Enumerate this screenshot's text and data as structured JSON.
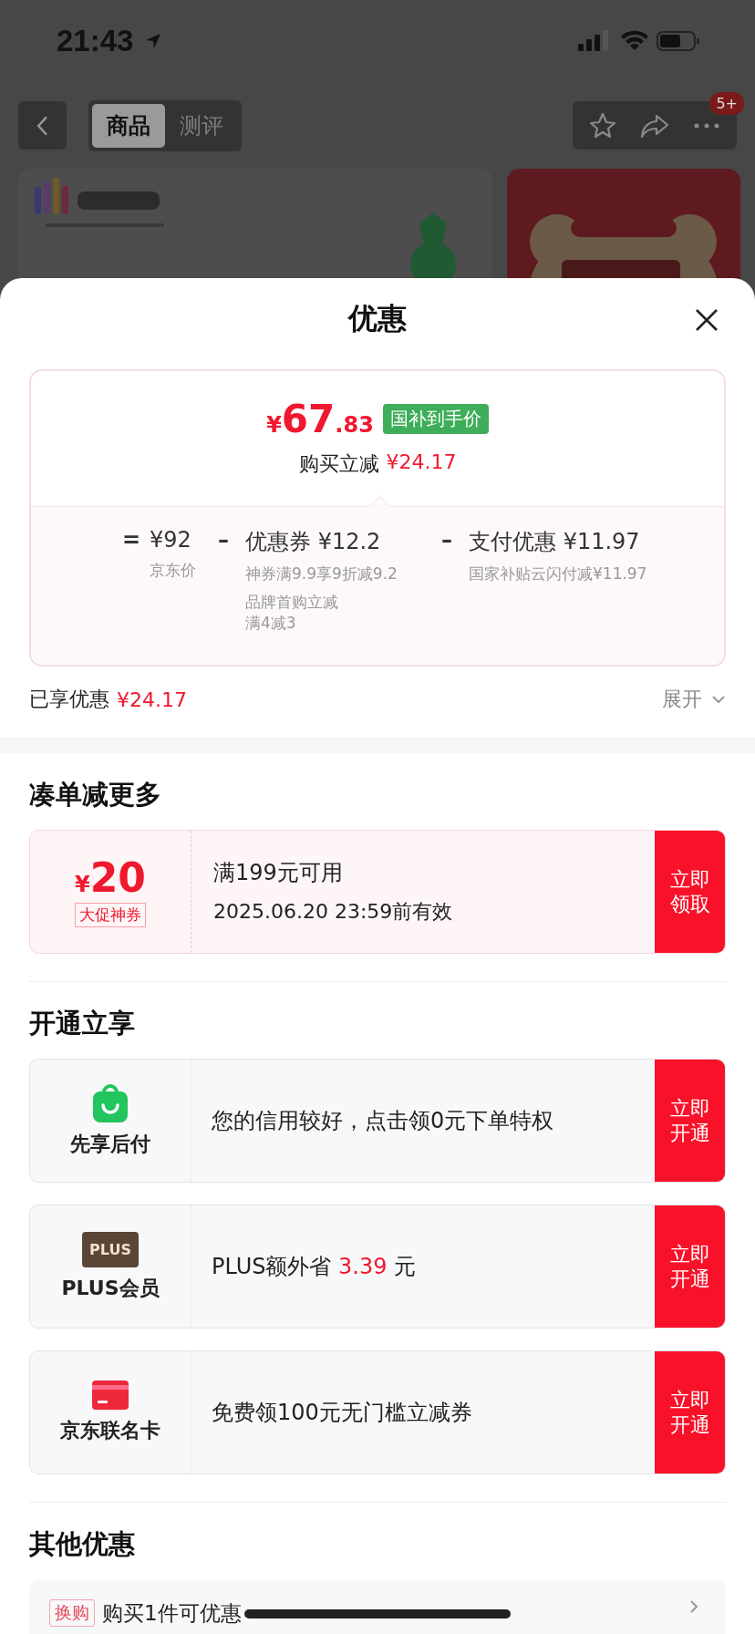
{
  "status_bar": {
    "time": "21:43"
  },
  "nav": {
    "tabs": [
      {
        "label": "商品",
        "selected": true
      },
      {
        "label": "测评",
        "selected": false
      }
    ],
    "badge": "5+"
  },
  "sheet": {
    "title": "优惠"
  },
  "price_card": {
    "currency": "¥",
    "price_int": "67",
    "price_dec": ".83",
    "tag": "国补到手价",
    "saving_label": "购买立减",
    "saving_amount": "¥24.17",
    "breakdown": [
      {
        "op": "=",
        "amount": "¥92",
        "notes": [
          [
            "京东价"
          ]
        ]
      },
      {
        "op": "–",
        "label": "优惠券",
        "amount": "¥12.2",
        "notes": [
          [
            "神券满9.9享9折减9.2"
          ],
          [
            "品牌首购立减",
            "满4减3"
          ]
        ]
      },
      {
        "op": "–",
        "label": "支付优惠",
        "amount": "¥11.97",
        "notes": [
          [
            "国家补贴云闪付减¥11.97"
          ]
        ]
      }
    ]
  },
  "enjoyed": {
    "label": "已享优惠",
    "amount": "¥24.17",
    "expand": "展开"
  },
  "more_section": {
    "title": "凑单减更多",
    "coupon": {
      "currency": "¥",
      "amount": "20",
      "tag": "大促神券",
      "condition": "满199元可用",
      "validity": "2025.06.20 23:59前有效",
      "action": "立即领取"
    }
  },
  "open_section": {
    "title": "开通立享",
    "offers": [
      {
        "kind": "bag",
        "name": "先享后付",
        "text": "您的信用较好，点击领0元下单特权",
        "action": "立即开通"
      },
      {
        "kind": "plus",
        "icon_text": "PLUS",
        "name": "PLUS会员",
        "text": "PLUS额外省 ",
        "highlight": "3.39",
        "after": " 元",
        "action": "立即开通"
      },
      {
        "kind": "card",
        "name": "京东联名卡",
        "text": "免费领100元无门槛立减券",
        "action": "立即开通"
      }
    ]
  },
  "other_section": {
    "title": "其他优惠",
    "items": [
      {
        "tag": "换购",
        "text": "购买1件可优惠"
      }
    ]
  }
}
